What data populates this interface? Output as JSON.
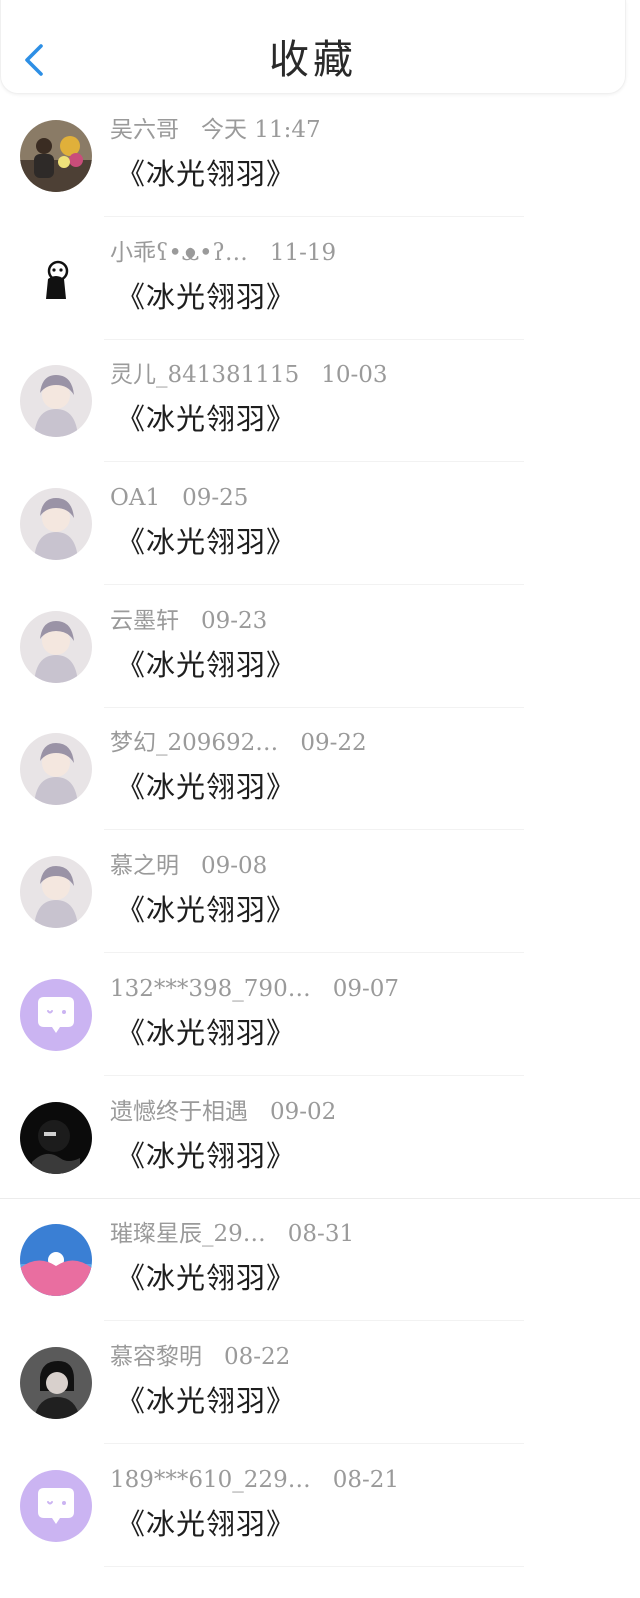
{
  "header": {
    "title": "收藏",
    "back_icon": "chevron-left-icon",
    "accent_color": "#2d8fe5"
  },
  "items": [
    {
      "name": "吴六哥",
      "time": "今天 11:47",
      "content": "《冰光翎羽》",
      "avatar": "photo-avatar"
    },
    {
      "name": "小乖ʕ•ᴥ•ʔ…",
      "time": "11-19",
      "content": "《冰光翎羽》",
      "avatar": "cartoon-avatar"
    },
    {
      "name": "灵儿_841381115",
      "time": "10-03",
      "content": "《冰光翎羽》",
      "avatar": "anime-avatar"
    },
    {
      "name": "OA1",
      "time": "09-25",
      "content": "《冰光翎羽》",
      "avatar": "anime-avatar"
    },
    {
      "name": "云墨轩",
      "time": "09-23",
      "content": "《冰光翎羽》",
      "avatar": "anime-avatar"
    },
    {
      "name": "梦幻_209692…",
      "time": "09-22",
      "content": "《冰光翎羽》",
      "avatar": "anime-avatar"
    },
    {
      "name": "慕之明",
      "time": "09-08",
      "content": "《冰光翎羽》",
      "avatar": "anime-avatar"
    },
    {
      "name": "132***398_790…",
      "time": "09-07",
      "content": "《冰光翎羽》",
      "avatar": "default-chat-avatar"
    },
    {
      "name": "遗憾终于相遇",
      "time": "09-02",
      "content": "《冰光翎羽》",
      "avatar": "dark-avatar"
    },
    {
      "name": "璀璨星辰_29…",
      "time": "08-31",
      "content": "《冰光翎羽》",
      "avatar": "scenery-avatar"
    },
    {
      "name": "慕容黎明",
      "time": "08-22",
      "content": "《冰光翎羽》",
      "avatar": "portrait-avatar"
    },
    {
      "name": "189***610_229…",
      "time": "08-21",
      "content": "《冰光翎羽》",
      "avatar": "default-chat-avatar"
    }
  ]
}
